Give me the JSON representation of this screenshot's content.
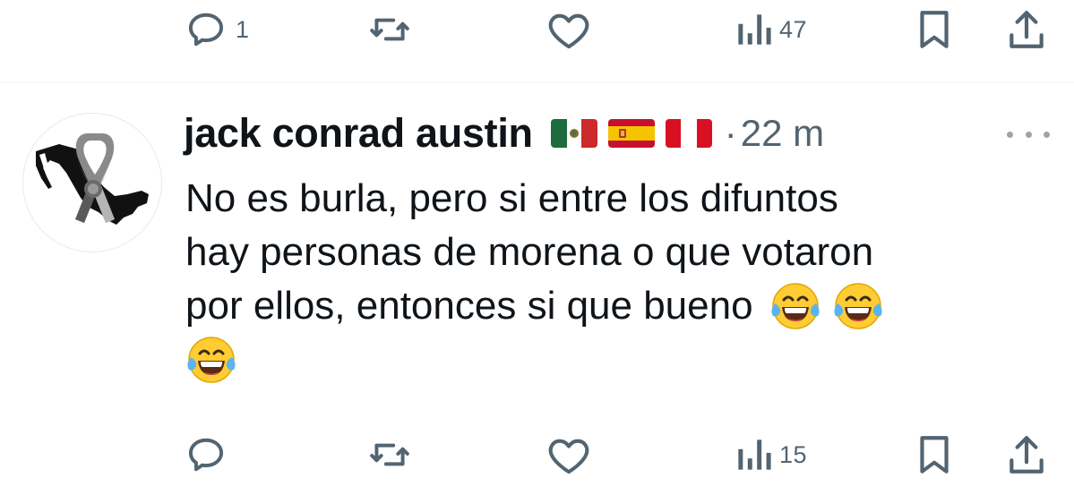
{
  "top_action_bar": {
    "reply_count": "1",
    "retweet_count": "",
    "like_count": "",
    "views_count": "47"
  },
  "reply": {
    "author_name": "jack conrad austin",
    "flags": [
      "mexico-flag",
      "spain-flag",
      "peru-flag"
    ],
    "separator": "·",
    "timestamp": "22 m",
    "text_lines": [
      "No es burla, pero si entre los difuntos",
      "hay personas de morena o que votaron",
      "por ellos, entonces si que bueno"
    ],
    "emoji": "face-with-tears-of-joy"
  },
  "bottom_action_bar": {
    "reply_count": "",
    "retweet_count": "",
    "like_count": "",
    "views_count": "15"
  },
  "colors": {
    "text": "#0f1419",
    "secondary": "#536471",
    "divider": "#eff3f4"
  }
}
